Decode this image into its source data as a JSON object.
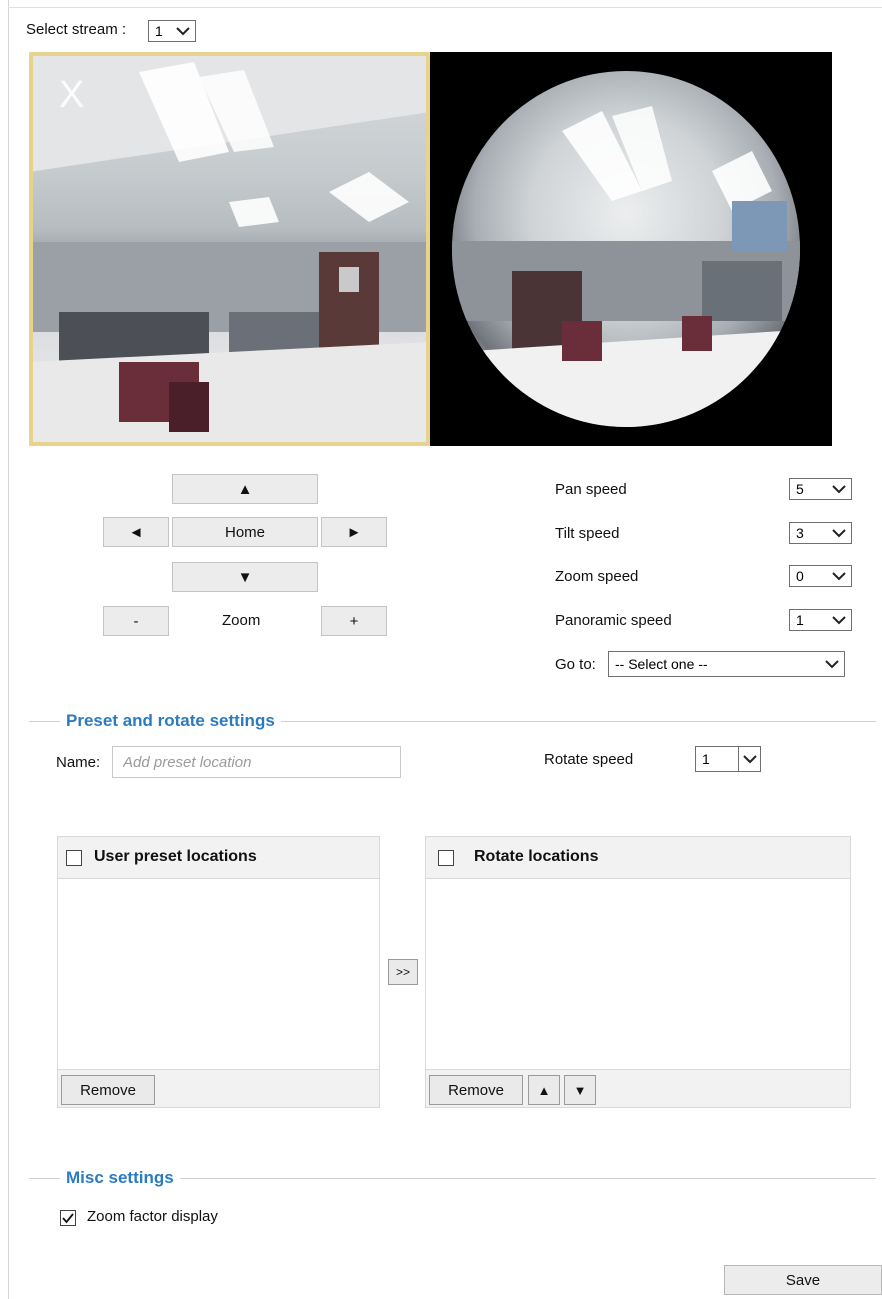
{
  "stream": {
    "label": "Select stream :",
    "value": "1"
  },
  "ptz": {
    "up": "▲",
    "down": "▼",
    "left": "◄",
    "right": "►",
    "home": "Home",
    "zoom_label": "Zoom",
    "zoom_out": "-",
    "zoom_in": "+"
  },
  "speeds": [
    {
      "label": "Pan speed",
      "value": "5"
    },
    {
      "label": "Tilt speed",
      "value": "3"
    },
    {
      "label": "Zoom speed",
      "value": "0"
    },
    {
      "label": "Panoramic speed",
      "value": "1"
    }
  ],
  "goto": {
    "label": "Go to:",
    "value": "-- Select one --"
  },
  "preset": {
    "title": "Preset and rotate settings",
    "name_label": "Name:",
    "name_placeholder": "Add preset location",
    "rotate_label": "Rotate speed",
    "rotate_value": "1",
    "user_list_title": "User preset locations",
    "rotate_list_title": "Rotate locations",
    "transfer": ">>",
    "remove_left": "Remove",
    "remove_right": "Remove",
    "move_up": "▲",
    "move_down": "▼"
  },
  "misc": {
    "title": "Misc settings",
    "zoom_factor_label": "Zoom factor display",
    "zoom_factor_checked": true
  },
  "save": "Save",
  "colors": {
    "accent": "#2b7bbf",
    "selection_frame": "#e5d38e"
  }
}
